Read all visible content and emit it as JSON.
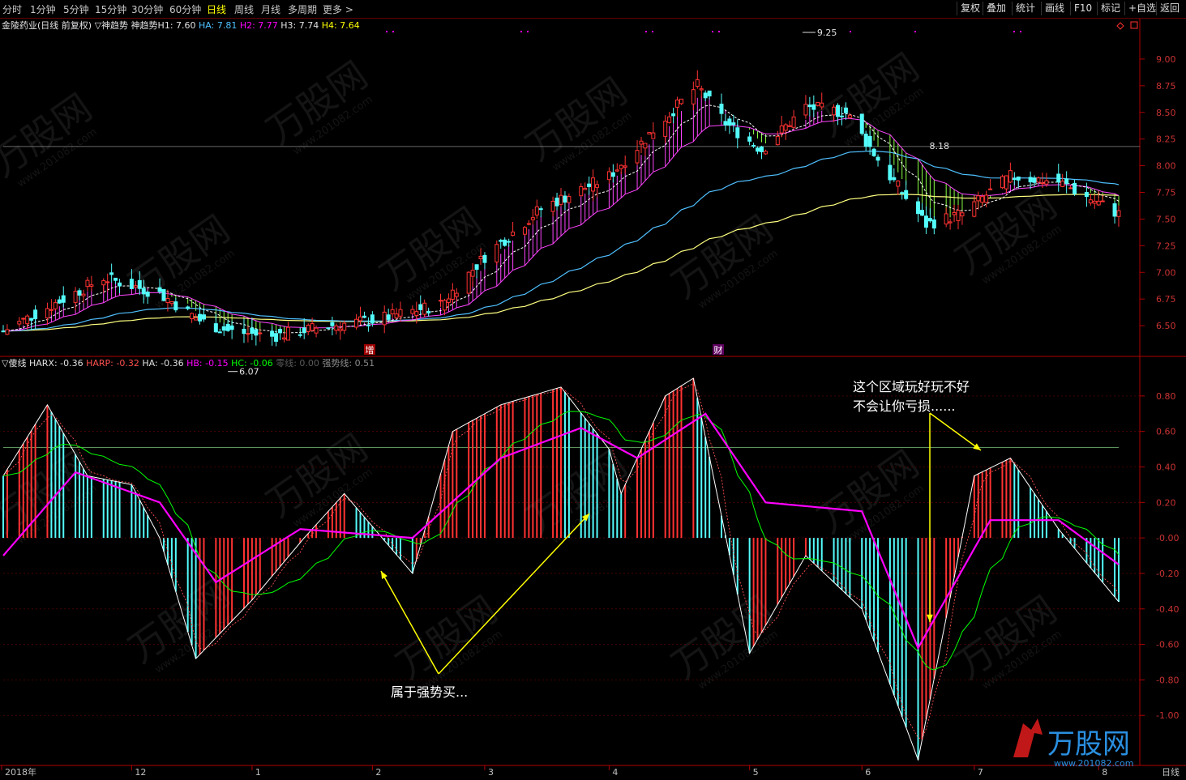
{
  "toolbar": {
    "timeframes": [
      "分时",
      "1分钟",
      "5分钟",
      "15分钟",
      "30分钟",
      "60分钟",
      "日线",
      "周线",
      "月线",
      "多周期",
      "更多 >"
    ],
    "active_timeframe": "日线",
    "right_buttons": [
      "复权",
      "叠加",
      "统计",
      "画线",
      "F10",
      "标记",
      "+自选",
      "返回"
    ]
  },
  "main_panel": {
    "stock_title": "金陵药业(日线 前复权)",
    "indicator_name": "▽神趋势",
    "indicator_label": "神趋势H1:",
    "h1": "7.60",
    "ha_label": "HA:",
    "ha": "7.81",
    "h2_label": "H2:",
    "h2": "7.77",
    "h3_label": "H3:",
    "h3": "7.74",
    "h4_label": "H4:",
    "h4": "7.64",
    "high_label": "9.25",
    "low_label": "6.07",
    "ref_label": "8.18",
    "marker_zeng": "增",
    "marker_cai": "财",
    "y_ticks": [
      "9.00",
      "8.75",
      "8.50",
      "8.25",
      "8.00",
      "7.75",
      "7.50",
      "7.25",
      "7.00",
      "6.75",
      "6.50"
    ]
  },
  "sub_panel": {
    "indicator_name": "▽傻线",
    "harx_label": "HARX:",
    "harx": "-0.36",
    "harp_label": "HARP:",
    "harp": "-0.32",
    "ha_label": "HA:",
    "ha": "-0.36",
    "hb_label": "HB:",
    "hb": "-0.15",
    "hc_label": "HC:",
    "hc": "-0.06",
    "zero_label": "零线:",
    "zero": "0.00",
    "strong_label": "强势线:",
    "strong": "0.51",
    "y_ticks": [
      "0.80",
      "0.60",
      "0.40",
      "0.20",
      "-0.00",
      "-0.20",
      "-0.40",
      "-0.60",
      "-0.80",
      "-1.00"
    ],
    "annotation_buy": "属于强势买...",
    "annotation_zone_line1": "这个区域玩好玩不好",
    "annotation_zone_line2": "不会让你亏损......"
  },
  "x_axis": {
    "labels": [
      "2018年",
      "12",
      "1",
      "2",
      "3",
      "4",
      "5",
      "6",
      "7",
      "8"
    ],
    "period_label": "日线"
  },
  "watermark": {
    "brand": "万股网",
    "url": "www.201082.com"
  },
  "colors": {
    "up": "#ff3232",
    "down": "#54fcfc",
    "magenta": "#ff00ff",
    "green": "#00ff00",
    "yellow": "#ffff00",
    "axis": "#b00000",
    "grid": "#5a0000",
    "ma_blue": "#4fc0ff",
    "ma_yellow": "#ffff80",
    "ribbon_up": "#ff44ff",
    "ribbon_down": "#88ff44"
  },
  "chart_data": [
    {
      "type": "candlestick",
      "title": "金陵药业(日线 前复权)",
      "y_range": [
        6.25,
        9.25
      ],
      "y_ticks": [
        6.5,
        6.75,
        7.0,
        7.25,
        7.5,
        7.75,
        8.0,
        8.25,
        8.5,
        8.75,
        9.0
      ],
      "high": 9.25,
      "low": 6.07,
      "reference_line": 8.18,
      "close_anchors": [
        {
          "x": "2018-11-01",
          "close": 6.45
        },
        {
          "x": "2018-11-26",
          "close": 6.95
        },
        {
          "x": "2018-12-10",
          "close": 6.8
        },
        {
          "x": "2018-12-20",
          "close": 6.55
        },
        {
          "x": "2018-12-27",
          "close": 6.45
        },
        {
          "x": "2019-01-07",
          "close": 6.4
        },
        {
          "x": "2019-01-21",
          "close": 6.5
        },
        {
          "x": "2019-02-01",
          "close": 6.55
        },
        {
          "x": "2019-02-18",
          "close": 6.7
        },
        {
          "x": "2019-03-01",
          "close": 7.15
        },
        {
          "x": "2019-03-15",
          "close": 7.6
        },
        {
          "x": "2019-04-01",
          "close": 7.9
        },
        {
          "x": "2019-04-15",
          "close": 8.45
        },
        {
          "x": "2019-04-23",
          "close": 8.75
        },
        {
          "x": "2019-04-30",
          "close": 8.4
        },
        {
          "x": "2019-05-09",
          "close": 8.15
        },
        {
          "x": "2019-05-20",
          "close": 8.55
        },
        {
          "x": "2019-05-30",
          "close": 8.5
        },
        {
          "x": "2019-06-10",
          "close": 7.9
        },
        {
          "x": "2019-06-19",
          "close": 7.45
        },
        {
          "x": "2019-06-28",
          "close": 7.55
        },
        {
          "x": "2019-07-10",
          "close": 7.9
        },
        {
          "x": "2019-07-22",
          "close": 7.85
        },
        {
          "x": "2019-08-06",
          "close": 7.55
        }
      ]
    },
    {
      "type": "bar",
      "title": "傻线",
      "y_range": [
        -1.25,
        0.95
      ],
      "y_ticks": [
        0.8,
        0.6,
        0.4,
        0.2,
        0.0,
        -0.2,
        -0.4,
        -0.6,
        -0.8,
        -1.0
      ],
      "strong_line": 0.51,
      "zero_line": 0.0,
      "series": [
        {
          "name": "HA",
          "values_anchors": [
            {
              "x": "2018-11-01",
              "y": 0.35
            },
            {
              "x": "2018-11-12",
              "y": 0.75
            },
            {
              "x": "2018-11-22",
              "y": 0.35
            },
            {
              "x": "2018-12-03",
              "y": 0.3
            },
            {
              "x": "2018-12-10",
              "y": 0.0
            },
            {
              "x": "2018-12-19",
              "y": -0.68
            },
            {
              "x": "2019-01-02",
              "y": -0.35
            },
            {
              "x": "2019-01-15",
              "y": 0.0
            },
            {
              "x": "2019-01-25",
              "y": 0.25
            },
            {
              "x": "2019-02-11",
              "y": -0.2
            },
            {
              "x": "2019-02-21",
              "y": 0.6
            },
            {
              "x": "2019-03-05",
              "y": 0.75
            },
            {
              "x": "2019-03-20",
              "y": 0.85
            },
            {
              "x": "2019-04-01",
              "y": 0.5
            },
            {
              "x": "2019-04-04",
              "y": 0.25
            },
            {
              "x": "2019-04-15",
              "y": 0.8
            },
            {
              "x": "2019-04-22",
              "y": 0.9
            },
            {
              "x": "2019-05-06",
              "y": -0.65
            },
            {
              "x": "2019-05-20",
              "y": -0.1
            },
            {
              "x": "2019-06-03",
              "y": -0.4
            },
            {
              "x": "2019-06-17",
              "y": -1.25
            },
            {
              "x": "2019-07-01",
              "y": 0.35
            },
            {
              "x": "2019-07-10",
              "y": 0.45
            },
            {
              "x": "2019-07-22",
              "y": 0.05
            },
            {
              "x": "2019-08-06",
              "y": -0.36
            }
          ]
        },
        {
          "name": "HB",
          "values_anchors": [
            {
              "x": "2018-11-01",
              "y": -0.1
            },
            {
              "x": "2018-11-19",
              "y": 0.37
            },
            {
              "x": "2018-12-10",
              "y": 0.2
            },
            {
              "x": "2018-12-24",
              "y": -0.25
            },
            {
              "x": "2019-01-14",
              "y": 0.05
            },
            {
              "x": "2019-02-11",
              "y": 0.0
            },
            {
              "x": "2019-03-05",
              "y": 0.45
            },
            {
              "x": "2019-03-25",
              "y": 0.62
            },
            {
              "x": "2019-04-08",
              "y": 0.45
            },
            {
              "x": "2019-04-25",
              "y": 0.7
            },
            {
              "x": "2019-05-10",
              "y": 0.2
            },
            {
              "x": "2019-06-03",
              "y": 0.15
            },
            {
              "x": "2019-06-17",
              "y": -0.62
            },
            {
              "x": "2019-07-05",
              "y": 0.1
            },
            {
              "x": "2019-07-22",
              "y": 0.1
            },
            {
              "x": "2019-08-06",
              "y": -0.15
            }
          ]
        }
      ]
    }
  ]
}
